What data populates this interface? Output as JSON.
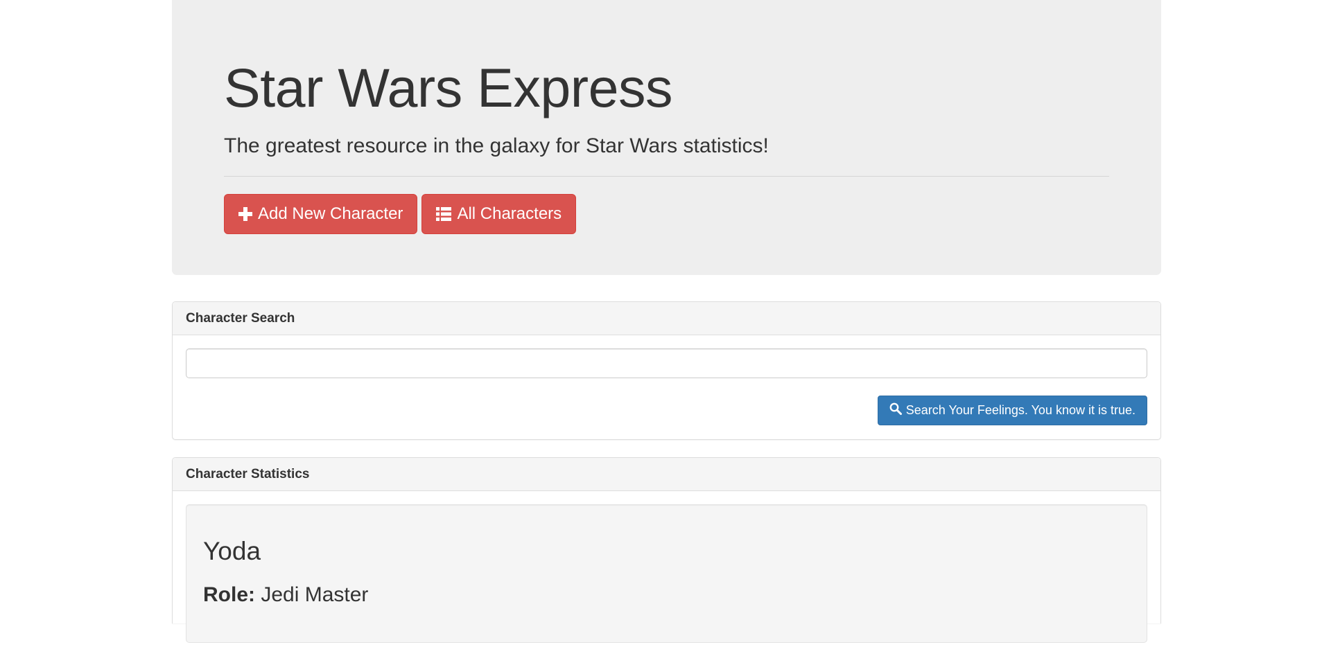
{
  "header": {
    "title": "Star Wars Express",
    "lead": "The greatest resource in the galaxy for Star Wars statistics!",
    "buttons": [
      {
        "label": "Add New Character",
        "icon": "plus-icon"
      },
      {
        "label": "All Characters",
        "icon": "list-icon"
      }
    ]
  },
  "search_panel": {
    "heading": "Character Search",
    "input_value": "",
    "input_placeholder": "",
    "button_label": "Search Your Feelings. You know it is true.",
    "button_icon": "search-icon"
  },
  "stats_panel": {
    "heading": "Character Statistics",
    "character": {
      "name": "Yoda",
      "role_label": "Role:",
      "role_value": "Jedi Master"
    }
  },
  "colors": {
    "danger": "#d9534f",
    "primary": "#337ab7",
    "jumbotron_bg": "#eeeeee"
  }
}
